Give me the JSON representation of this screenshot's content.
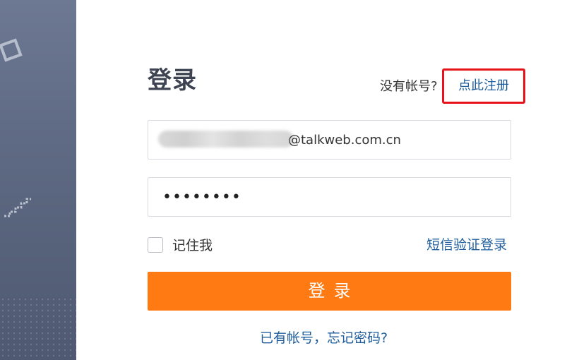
{
  "header": {
    "title": "登录",
    "no_account_text": "没有帐号?",
    "register_link": "点此注册"
  },
  "form": {
    "email_value": "@talkweb.com.cn",
    "password_value": "••••••••",
    "remember_label": "记住我",
    "sms_login_link": "短信验证登录",
    "login_button": "登录",
    "forgot_link": "已有帐号，忘记密码?"
  },
  "colors": {
    "accent_button": "#ff7a12",
    "link": "#1f5d9c",
    "highlight_border": "#e8121a",
    "side_panel": "#5f6a84"
  },
  "icons": {
    "side_deco_square": "square-outline-icon",
    "side_deco_stairs": "stairs-icon"
  }
}
